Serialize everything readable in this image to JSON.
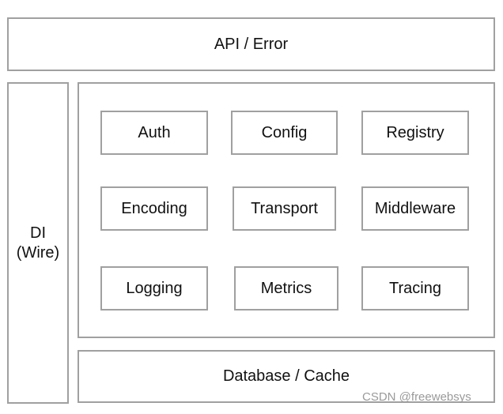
{
  "layers": {
    "api": "API / Error",
    "di_line1": "DI",
    "di_line2": "(Wire)",
    "database": "Database / Cache"
  },
  "components": [
    "Auth",
    "Config",
    "Registry",
    "Encoding",
    "Transport",
    "Middleware",
    "Logging",
    "Metrics",
    "Tracing"
  ],
  "watermark": "CSDN @freewebsys"
}
